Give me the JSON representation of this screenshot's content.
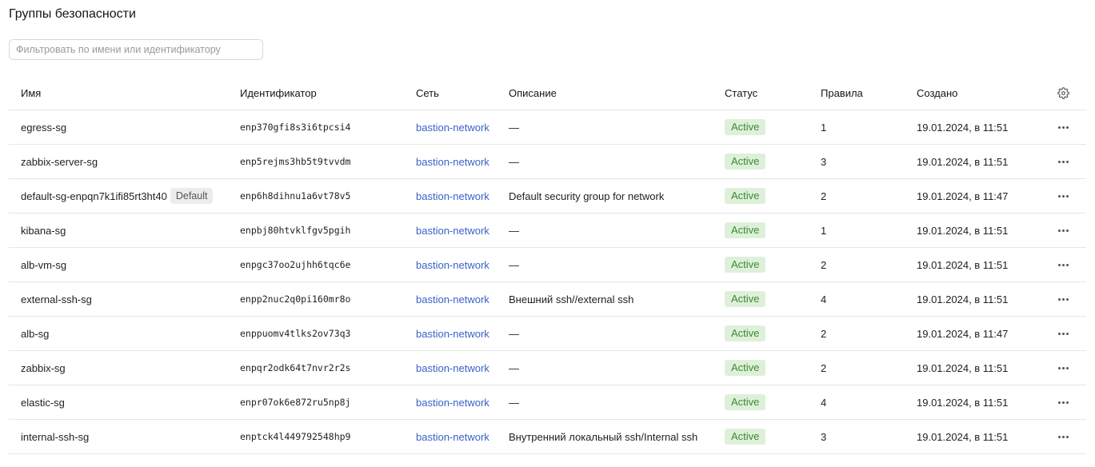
{
  "page": {
    "title": "Группы безопасности"
  },
  "filter": {
    "placeholder": "Фильтровать по имени или идентификатору",
    "value": ""
  },
  "table": {
    "columns": {
      "name": "Имя",
      "id": "Идентификатор",
      "network": "Сеть",
      "description": "Описание",
      "status": "Статус",
      "rules": "Правила",
      "created": "Создано"
    },
    "settings_icon": "gear-icon",
    "actions_icon": "more-horizontal-icon",
    "rows": [
      {
        "name": "egress-sg",
        "default_badge": "",
        "id": "enp370gfi8s3i6tpcsi4",
        "network": "bastion-network",
        "description": "—",
        "status": "Active",
        "rules": "1",
        "created": "19.01.2024, в 11:51"
      },
      {
        "name": "zabbix-server-sg",
        "default_badge": "",
        "id": "enp5rejms3hb5t9tvvdm",
        "network": "bastion-network",
        "description": "—",
        "status": "Active",
        "rules": "3",
        "created": "19.01.2024, в 11:51"
      },
      {
        "name": "default-sg-enpqn7k1ifi85rt3ht40",
        "default_badge": "Default",
        "id": "enp6h8dihnu1a6vt78v5",
        "network": "bastion-network",
        "description": "Default security group for network",
        "status": "Active",
        "rules": "2",
        "created": "19.01.2024, в 11:47"
      },
      {
        "name": "kibana-sg",
        "default_badge": "",
        "id": "enpbj80htvklfgv5pgih",
        "network": "bastion-network",
        "description": "—",
        "status": "Active",
        "rules": "1",
        "created": "19.01.2024, в 11:51"
      },
      {
        "name": "alb-vm-sg",
        "default_badge": "",
        "id": "enpgc37oo2ujhh6tqc6e",
        "network": "bastion-network",
        "description": "—",
        "status": "Active",
        "rules": "2",
        "created": "19.01.2024, в 11:51"
      },
      {
        "name": "external-ssh-sg",
        "default_badge": "",
        "id": "enpp2nuc2q0pi160mr8o",
        "network": "bastion-network",
        "description": "Внешний ssh//external ssh",
        "status": "Active",
        "rules": "4",
        "created": "19.01.2024, в 11:51"
      },
      {
        "name": "alb-sg",
        "default_badge": "",
        "id": "enppuomv4tlks2ov73q3",
        "network": "bastion-network",
        "description": "—",
        "status": "Active",
        "rules": "2",
        "created": "19.01.2024, в 11:47"
      },
      {
        "name": "zabbix-sg",
        "default_badge": "",
        "id": "enpqr2odk64t7nvr2r2s",
        "network": "bastion-network",
        "description": "—",
        "status": "Active",
        "rules": "2",
        "created": "19.01.2024, в 11:51"
      },
      {
        "name": "elastic-sg",
        "default_badge": "",
        "id": "enpr07ok6e872ru5np8j",
        "network": "bastion-network",
        "description": "—",
        "status": "Active",
        "rules": "4",
        "created": "19.01.2024, в 11:51"
      },
      {
        "name": "internal-ssh-sg",
        "default_badge": "",
        "id": "enptck4l449792548hp9",
        "network": "bastion-network",
        "description": "Внутренний локальный ssh/Internal ssh",
        "status": "Active",
        "rules": "3",
        "created": "19.01.2024, в 11:51"
      }
    ]
  },
  "colors": {
    "link": "#3a62c8",
    "status_active_bg": "#def0d9",
    "status_active_text": "#3b8a34",
    "badge_default_bg": "#ececec"
  }
}
